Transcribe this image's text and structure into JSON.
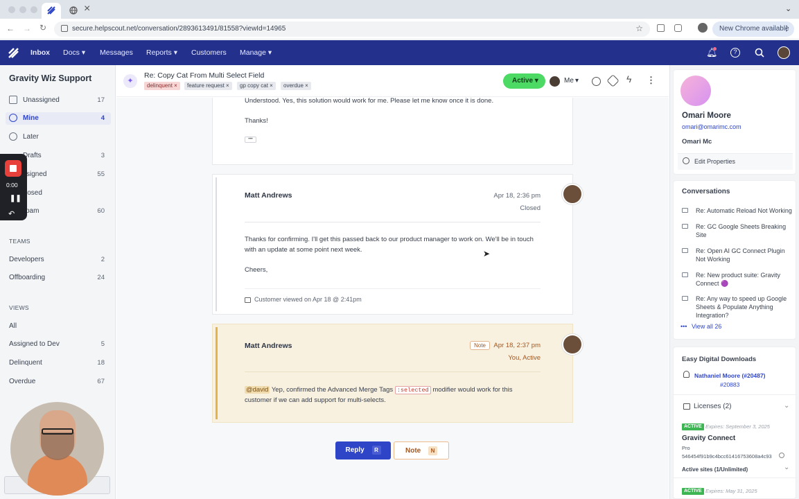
{
  "browser": {
    "url": "secure.helpscout.net/conversation/2893613491/81558?viewId=14965",
    "new_chrome": "New Chrome available"
  },
  "nav": {
    "items": [
      "Inbox",
      "Docs",
      "Messages",
      "Reports",
      "Customers",
      "Manage"
    ]
  },
  "sidebar": {
    "mailbox": "Gravity Wiz Support",
    "folders": [
      {
        "label": "Unassigned",
        "count": "17"
      },
      {
        "label": "Mine",
        "count": "4"
      },
      {
        "label": "Later",
        "count": ""
      },
      {
        "label": "Drafts",
        "count": "3"
      },
      {
        "label": "ssigned",
        "count": "55"
      },
      {
        "label": "losed",
        "count": ""
      },
      {
        "label": "pam",
        "count": "60"
      }
    ],
    "teams_heading": "TEAMS",
    "teams": [
      {
        "label": "Developers",
        "count": "2"
      },
      {
        "label": "Offboarding",
        "count": "24"
      }
    ],
    "views_heading": "VIEWS",
    "views": [
      {
        "label": "All",
        "count": ""
      },
      {
        "label": "Assigned to Dev",
        "count": "5"
      },
      {
        "label": "Delinquent",
        "count": "18"
      },
      {
        "label": "Overdue",
        "count": "67"
      }
    ]
  },
  "recorder": {
    "time": "0:00"
  },
  "conversation": {
    "subject": "Re: Copy Cat From Multi Select Field",
    "tags": [
      "delinquent",
      "feature request",
      "gp copy cat",
      "overdue"
    ],
    "status": "Active",
    "assignee": "Me",
    "thread": [
      {
        "body": [
          "Understood. Yes, this solution would work for me. Please let me know once it is done.",
          "Thanks!"
        ],
        "more": "•••"
      },
      {
        "author": "Matt Andrews",
        "time": "Apr 18, 2:36 pm",
        "state": "Closed",
        "body": [
          "Thanks for confirming. I'll get this passed back to our product manager to work on. We'll be in touch",
          "with an update at some point next week.",
          "Cheers,"
        ],
        "viewed": "Customer viewed on Apr 18 @ 2:41pm"
      },
      {
        "author": "Matt Andrews",
        "badge": "Note",
        "time": "Apr 18, 2:37 pm",
        "state": "You, Active",
        "mention": "@david",
        "text1": "Yep, confirmed the Advanced Merge Tags",
        "code": ":selected",
        "text2": "modifier would work for this",
        "text3": "customer if we can add support for multi-selects."
      }
    ],
    "reply_label": "Reply",
    "reply_key": "R",
    "note_label": "Note",
    "note_key": "N"
  },
  "customer": {
    "name": "Omari Moore",
    "email": "omari@omarimc.com",
    "company": "Omari Mc",
    "edit": "Edit Properties",
    "conversations_heading": "Conversations",
    "conversations": [
      "Re: Automatic Reload Not Working",
      "Re: GC Google Sheets Breaking Site",
      "Re: Open AI GC Connect Plugin Not Working",
      "Re: New product suite: Gravity Connect 🟣",
      "Re: Any way to speed up Google Sheets & Populate Anything Integration?"
    ],
    "view_all": "View all 26",
    "edd_heading": "Easy Digital Downloads",
    "edd_customer": "Nathaniel Moore (#20487)",
    "edd_id": "#20883",
    "licenses_heading": "Licenses (2)",
    "license1": {
      "badge": "ACTIVE",
      "expires": "Expires: September 3, 2025",
      "product": "Gravity Connect",
      "tier": "Pro",
      "key": "546454f91b9c4bcc61416753608a4c93",
      "sites": "Active sites (1/Unlimited)"
    },
    "license2": {
      "badge": "ACTIVE",
      "expires": "Expires: May 31, 2025"
    }
  },
  "colors": {
    "nav": "#24318c",
    "active": "#4cd964",
    "reply": "#2f45c8",
    "note": "#e6b24a"
  }
}
